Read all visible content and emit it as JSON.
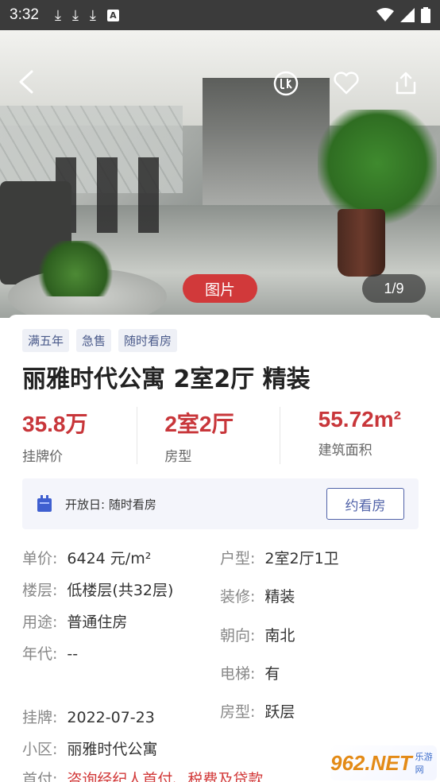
{
  "status": {
    "time": "3:32"
  },
  "photo": {
    "tag": "图片",
    "counter": "1/9"
  },
  "tags": [
    "满五年",
    "急售",
    "随时看房"
  ],
  "title": "丽雅时代公寓 2室2厅 精装",
  "stats": [
    {
      "value": "35.8万",
      "label": "挂牌价"
    },
    {
      "value": "2室2厅",
      "label": "房型"
    },
    {
      "value": "55.72m²",
      "label": "建筑面积"
    }
  ],
  "open_day": {
    "text": "开放日: 随时看房",
    "button": "约看房"
  },
  "details": {
    "left": [
      {
        "k": "单价:",
        "v": "6424 元/m²"
      },
      {
        "k": "楼层:",
        "v": "低楼层(共32层)"
      },
      {
        "k": "用途:",
        "v": "普通住房"
      },
      {
        "k": "年代:",
        "v": "--"
      },
      {
        "k": "挂牌:",
        "v": "2022-07-23"
      },
      {
        "k": "小区:",
        "v": "丽雅时代公寓"
      },
      {
        "k": "首付:",
        "v": "咨询经纪人首付、税费及贷款"
      }
    ],
    "right": [
      {
        "k": "户型:",
        "v": "2室2厅1卫"
      },
      {
        "k": "装修:",
        "v": "精装"
      },
      {
        "k": "朝向:",
        "v": "南北"
      },
      {
        "k": "电梯:",
        "v": "有"
      },
      {
        "k": "房型:",
        "v": "跃层"
      }
    ]
  },
  "watermark": {
    "brand": "962.NET",
    "sub": "乐游网"
  },
  "colors": {
    "price_red": "#c8363a",
    "accent_blue": "#5062a8",
    "photo_tag_red": "#d1393a"
  }
}
